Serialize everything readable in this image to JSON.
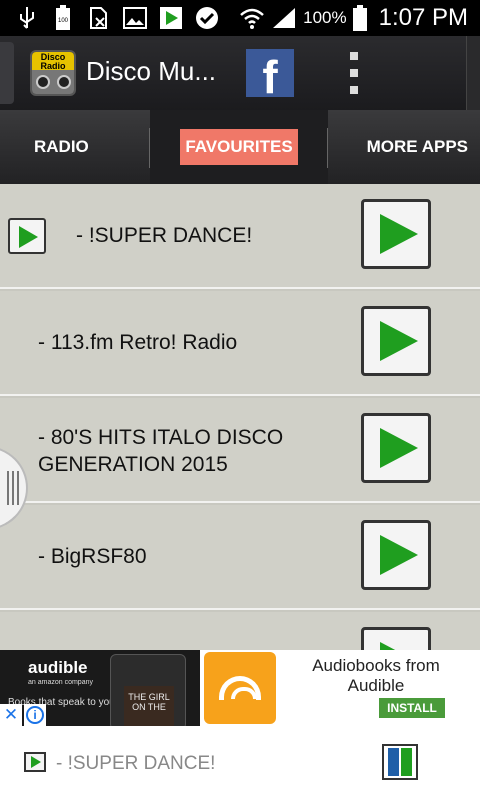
{
  "status_bar": {
    "battery_level": "100%",
    "time": "1:07 PM",
    "icons": [
      "usb-icon",
      "battery-100-icon",
      "no-sim-icon",
      "image-icon",
      "play-icon",
      "check-icon",
      "wifi-icon",
      "signal-icon",
      "battery-icon"
    ]
  },
  "app_bar": {
    "title": "Disco Mu...",
    "logo_text": "Disco Radio",
    "facebook_label": "f"
  },
  "tabs": [
    {
      "label": "RADIO",
      "selected": false
    },
    {
      "label": "FAVOURITES",
      "selected": true
    },
    {
      "label": "MORE APPS",
      "selected": false
    }
  ],
  "list": {
    "items": [
      {
        "label": "- !SUPER DANCE!",
        "playing": true
      },
      {
        "label": "- 113.fm Retro! Radio",
        "playing": false
      },
      {
        "label": "- 80'S HITS ITALO DISCO\nGENERATION 2015",
        "line1": "- 80'S HITS ITALO DISCO",
        "line2": "GENERATION 2015",
        "playing": false
      },
      {
        "label": "- BigRSF80",
        "playing": false
      },
      {
        "label": "",
        "playing": false
      }
    ]
  },
  "ad": {
    "brand": "audible",
    "brand_sub": "an amazon company",
    "snippet": "Books that speak to you",
    "book_text": "THE GIRL ON THE",
    "title": "Audiobooks from Audible",
    "install_label": "INSTALL",
    "close_label": "✕",
    "info_label": "i"
  },
  "player": {
    "now_playing": "- !SUPER DANCE!"
  },
  "colors": {
    "accent": "#f07868",
    "play_green": "#1f9e1f",
    "facebook": "#3b5998",
    "list_bg": "#d0d0c8",
    "install_green": "#4a9b3a",
    "audible_orange": "#f7a21b",
    "pause_blue": "#1f5fa8",
    "pause_green": "#1f9e1f"
  }
}
